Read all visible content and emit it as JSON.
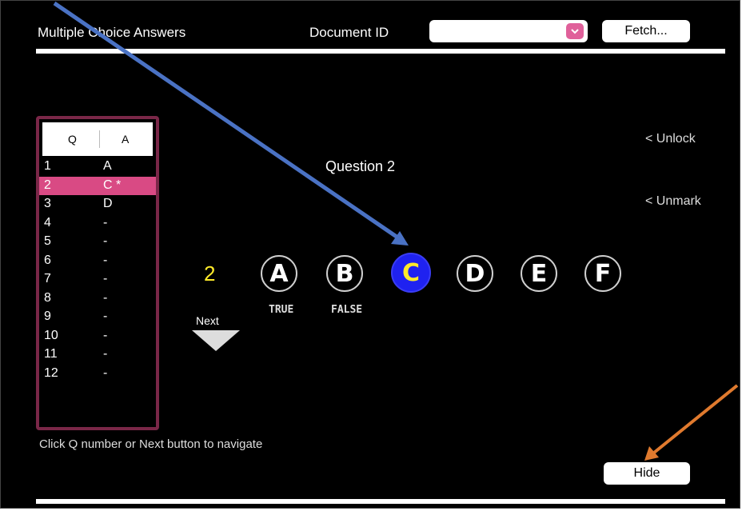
{
  "header": {
    "title": "Multiple Choice Answers",
    "document_id_label": "Document ID",
    "document_id_value": "",
    "fetch_label": "Fetch..."
  },
  "question_list": {
    "col_q": "Q",
    "col_a": "A",
    "selected_index": 1,
    "rows": [
      {
        "q": "1",
        "a": "A"
      },
      {
        "q": "2",
        "a": "C *"
      },
      {
        "q": "3",
        "a": "D"
      },
      {
        "q": "4",
        "a": "-"
      },
      {
        "q": "5",
        "a": "-"
      },
      {
        "q": "6",
        "a": "-"
      },
      {
        "q": "7",
        "a": "-"
      },
      {
        "q": "8",
        "a": "-"
      },
      {
        "q": "9",
        "a": "-"
      },
      {
        "q": "10",
        "a": "-"
      },
      {
        "q": "11",
        "a": "-"
      },
      {
        "q": "12",
        "a": "-"
      }
    ]
  },
  "current": {
    "question_title": "Question 2",
    "number": "2",
    "next_label": "Next"
  },
  "options": [
    {
      "letter": "A",
      "sublabel": "TRUE",
      "selected": false
    },
    {
      "letter": "B",
      "sublabel": "FALSE",
      "selected": false
    },
    {
      "letter": "C",
      "sublabel": "",
      "selected": true
    },
    {
      "letter": "D",
      "sublabel": "",
      "selected": false
    },
    {
      "letter": "E",
      "sublabel": "",
      "selected": false
    },
    {
      "letter": "F",
      "sublabel": "",
      "selected": false
    }
  ],
  "side": {
    "unlock": "< Unlock",
    "unmark": "< Unmark"
  },
  "footer": {
    "hint": "Click Q number or Next button to navigate",
    "hide_label": "Hide"
  },
  "colors": {
    "background": "#000000",
    "selected_row": "#d94a84",
    "list_border": "#7a2748",
    "selected_option": "#1f22f0",
    "highlight_text": "#ffeb2a",
    "annotation_blue": "#4a72c4",
    "annotation_orange": "#e07a2e"
  }
}
